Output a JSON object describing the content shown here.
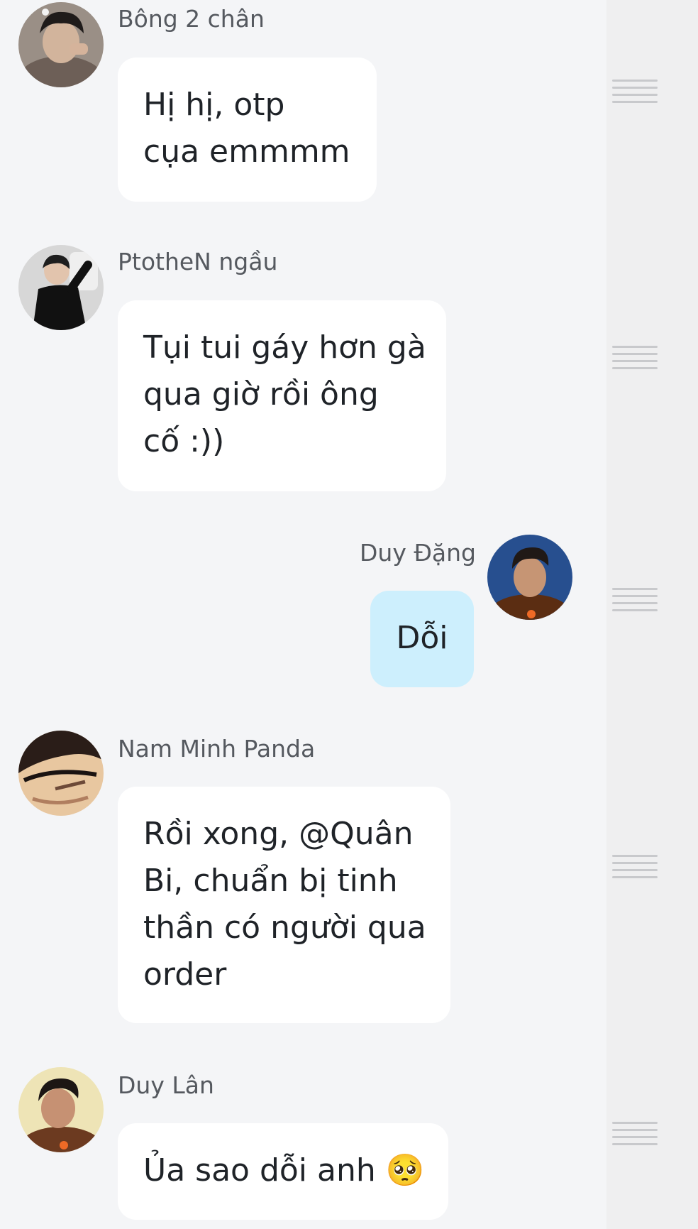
{
  "messages": [
    {
      "sender": "Bông 2 chân",
      "lines": [
        "Hị hị, otp",
        "cụa emmmm"
      ],
      "avatar_icon": "avatar-bong-2-chan"
    },
    {
      "sender": "PtotheN ngầu",
      "lines": [
        "Tụi tui gáy hơn gà",
        "qua giờ rồi ông",
        "cố :))"
      ],
      "avatar_icon": "avatar-ptothen-ngau"
    },
    {
      "sender": "Duy Đặng",
      "lines": [
        "Dỗi"
      ],
      "avatar_icon": "avatar-duy-dang",
      "mine": true
    },
    {
      "sender": "Nam Minh Panda",
      "lines": [
        "Rồi xong, @Quân",
        "Bi, chuẩn bị tinh",
        "thần có người qua",
        "order"
      ],
      "avatar_icon": "avatar-nam-minh-panda"
    },
    {
      "sender": "Duy Lân",
      "lines": [
        "Ủa sao dỗi anh"
      ],
      "emoji": "🥺",
      "avatar_icon": "avatar-duy-lan"
    }
  ],
  "colors": {
    "chat_background": "#f4f5f7",
    "bubble_other": "#ffffff",
    "bubble_mine": "#cdeffd",
    "text": "#1f2328",
    "sender_text": "#55595f",
    "grip": "#c8c9cc"
  }
}
